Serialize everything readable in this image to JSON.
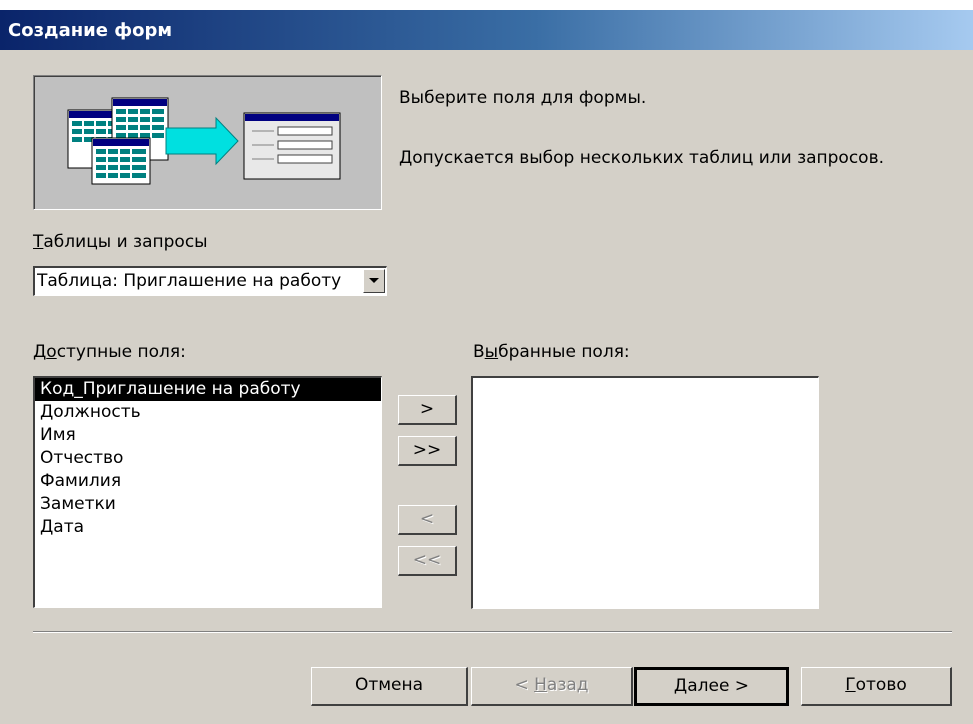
{
  "window": {
    "title": "Создание форм"
  },
  "intro": {
    "line1": "Выберите поля для формы.",
    "line2": "Допускается выбор нескольких таблиц или запросов."
  },
  "tables_label": {
    "mnemonic": "Т",
    "rest": "аблицы и запросы"
  },
  "combo": {
    "value": "Таблица: Приглашение на работу"
  },
  "available_label": {
    "pre": "Д",
    "mnemonic": "о",
    "rest": "ступные поля:"
  },
  "selected_label": {
    "pre": "В",
    "mnemonic": "ы",
    "rest": "бранные поля:"
  },
  "available_fields": [
    "Код_Приглашение на работу",
    "Должность",
    "Имя",
    "Отчество",
    "Фамилия",
    "Заметки",
    "Дата"
  ],
  "selected_fields": [],
  "move_buttons": {
    "add_one": ">",
    "add_all": ">>",
    "remove_one": "<",
    "remove_all": "<<"
  },
  "footer": {
    "cancel": "Отмена",
    "back_pre": "< ",
    "back_mnemonic": "Н",
    "back_rest": "азад",
    "next_mnemonic": "Д",
    "next_rest": "алее >",
    "finish_mnemonic": "Г",
    "finish_rest": "отово"
  },
  "colors": {
    "dialog_bg": "#d4d0c8",
    "title_start": "#0a246a",
    "title_end": "#a6caf0",
    "selection": "#000000"
  }
}
